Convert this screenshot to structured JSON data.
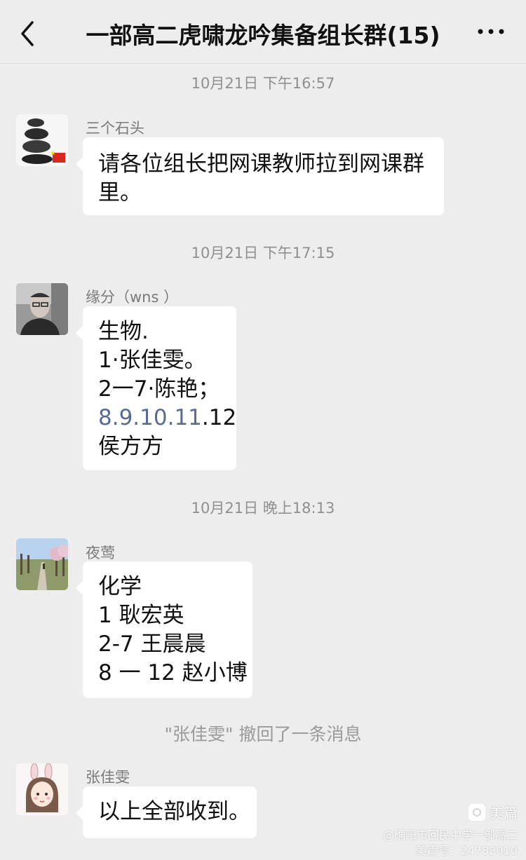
{
  "header": {
    "title": "一部高二虎啸龙吟集备组长群(15)",
    "back_icon": "chevron-left-icon",
    "more_icon": "more-dots-icon"
  },
  "messages": [
    {
      "time": "10月21日 下午16:57",
      "sender": "三个石头",
      "avatar": "stones-avatar",
      "lines": [
        "请各位组长把网课教师拉到网课群",
        "里。"
      ]
    },
    {
      "time": "10月21日 下午17:15",
      "sender": "缘分（wns ）",
      "avatar": "man-photo-avatar",
      "lines": [
        "生物.",
        "1·张佳雯。",
        "2一7·陈艳；",
        "",
        "侯方方"
      ],
      "line4_link": "8.9.10.11",
      "line4_rest": ".12"
    },
    {
      "time": "10月21日 晚上18:13",
      "sender": "夜莺",
      "avatar": "landscape-avatar",
      "lines": [
        "化学",
        "1 耿宏英",
        "2-7 王晨晨",
        "8 一 12 赵小博"
      ]
    },
    {
      "recall": "\"张佳雯\" 撤回了一条消息"
    },
    {
      "sender": "张佳雯",
      "avatar": "cartoon-girl-avatar",
      "lines": [
        "以上全部收到。"
      ]
    }
  ],
  "watermark": {
    "brand": "美篇",
    "line1": "@确阳市回民中学一部高二",
    "line2": "美篇号：24782010"
  },
  "colors": {
    "background": "#ededed",
    "bubble": "#ffffff",
    "link": "#576b95",
    "muted": "#8f8f8f"
  }
}
